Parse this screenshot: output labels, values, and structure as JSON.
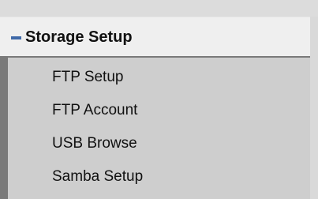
{
  "section": {
    "title": "Storage Setup",
    "collapse_icon": "minus-icon",
    "accent_color": "#3f69a8"
  },
  "menu": {
    "items": [
      {
        "label": "FTP Setup"
      },
      {
        "label": "FTP Account"
      },
      {
        "label": "USB Browse"
      },
      {
        "label": "Samba Setup"
      }
    ]
  }
}
